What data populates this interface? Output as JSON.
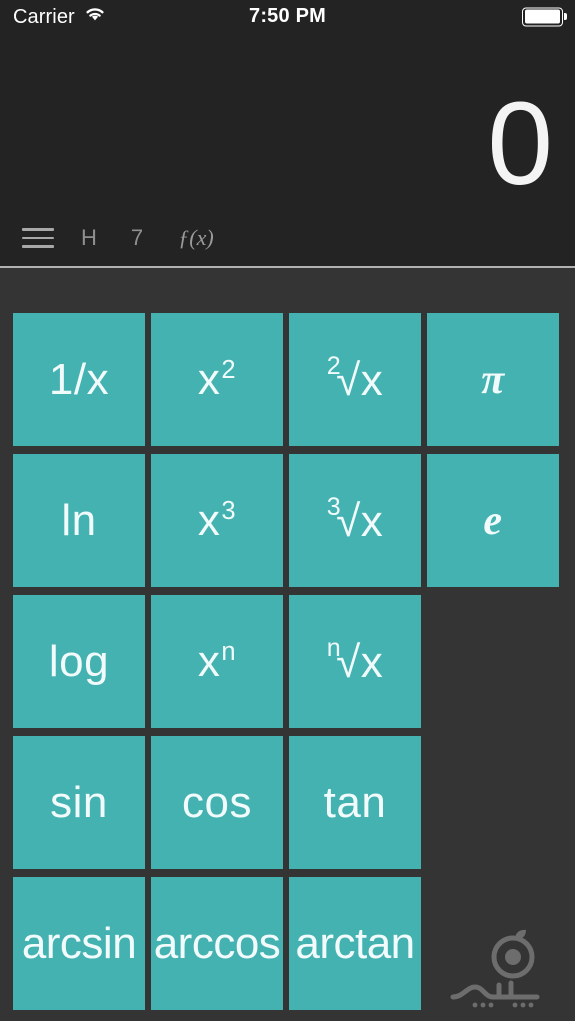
{
  "status_bar": {
    "carrier": "Carrier",
    "wifi_icon": "wifi-icon",
    "time": "7:50 PM",
    "battery_icon": "battery-full-icon"
  },
  "display": {
    "value": "0"
  },
  "toolbar": {
    "items": [
      {
        "name": "menu-button",
        "icon": "hamburger-menu-icon",
        "label": ""
      },
      {
        "name": "history-button",
        "icon": "",
        "label": "H"
      },
      {
        "name": "base-button",
        "icon": "",
        "label": "7"
      },
      {
        "name": "function-button",
        "icon": "",
        "label": "ƒ(x)"
      }
    ]
  },
  "keypad": {
    "rows": [
      [
        {
          "label": "1/x",
          "kind": "plain",
          "name": "key-reciprocal"
        },
        {
          "label": "x2",
          "base": "x",
          "exp": "2",
          "kind": "superscript",
          "name": "key-square"
        },
        {
          "label": "2√x",
          "index": "2",
          "radical": "√x",
          "kind": "radical",
          "name": "key-square-root"
        },
        {
          "label": "π",
          "kind": "constant",
          "name": "key-pi"
        }
      ],
      [
        {
          "label": "ln",
          "kind": "plain",
          "name": "key-natural-log"
        },
        {
          "label": "x3",
          "base": "x",
          "exp": "3",
          "kind": "superscript",
          "name": "key-cube"
        },
        {
          "label": "3√x",
          "index": "3",
          "radical": "√x",
          "kind": "radical",
          "name": "key-cube-root"
        },
        {
          "label": "e",
          "kind": "constant",
          "name": "key-euler"
        }
      ],
      [
        {
          "label": "log",
          "kind": "plain",
          "name": "key-log"
        },
        {
          "label": "xn",
          "base": "x",
          "exp": "n",
          "kind": "superscript",
          "name": "key-power-n"
        },
        {
          "label": "n√x",
          "index": "n",
          "radical": "√x",
          "kind": "radical",
          "name": "key-nth-root"
        },
        {
          "label": "",
          "kind": "empty",
          "name": "key-empty-r3c4"
        }
      ],
      [
        {
          "label": "sin",
          "kind": "plain",
          "name": "key-sin"
        },
        {
          "label": "cos",
          "kind": "plain",
          "name": "key-cos"
        },
        {
          "label": "tan",
          "kind": "plain",
          "name": "key-tan"
        },
        {
          "label": "",
          "kind": "empty",
          "name": "key-empty-r4c4"
        }
      ],
      [
        {
          "label": "arcsin",
          "kind": "wide",
          "name": "key-arcsin"
        },
        {
          "label": "arccos",
          "kind": "wide",
          "name": "key-arccos"
        },
        {
          "label": "arctan",
          "kind": "wide",
          "name": "key-arctan"
        },
        {
          "label": "",
          "kind": "empty",
          "name": "key-empty-r5c4"
        }
      ]
    ]
  },
  "watermark": {
    "name": "sibche-logo-watermark"
  },
  "colors": {
    "key_teal": "#45b2b2",
    "key_text": "#f2fbfb",
    "display_bg": "#232323",
    "keypad_bg": "#343434",
    "divider": "#b2b2b2",
    "toolbar_text": "#9b9b9b"
  }
}
